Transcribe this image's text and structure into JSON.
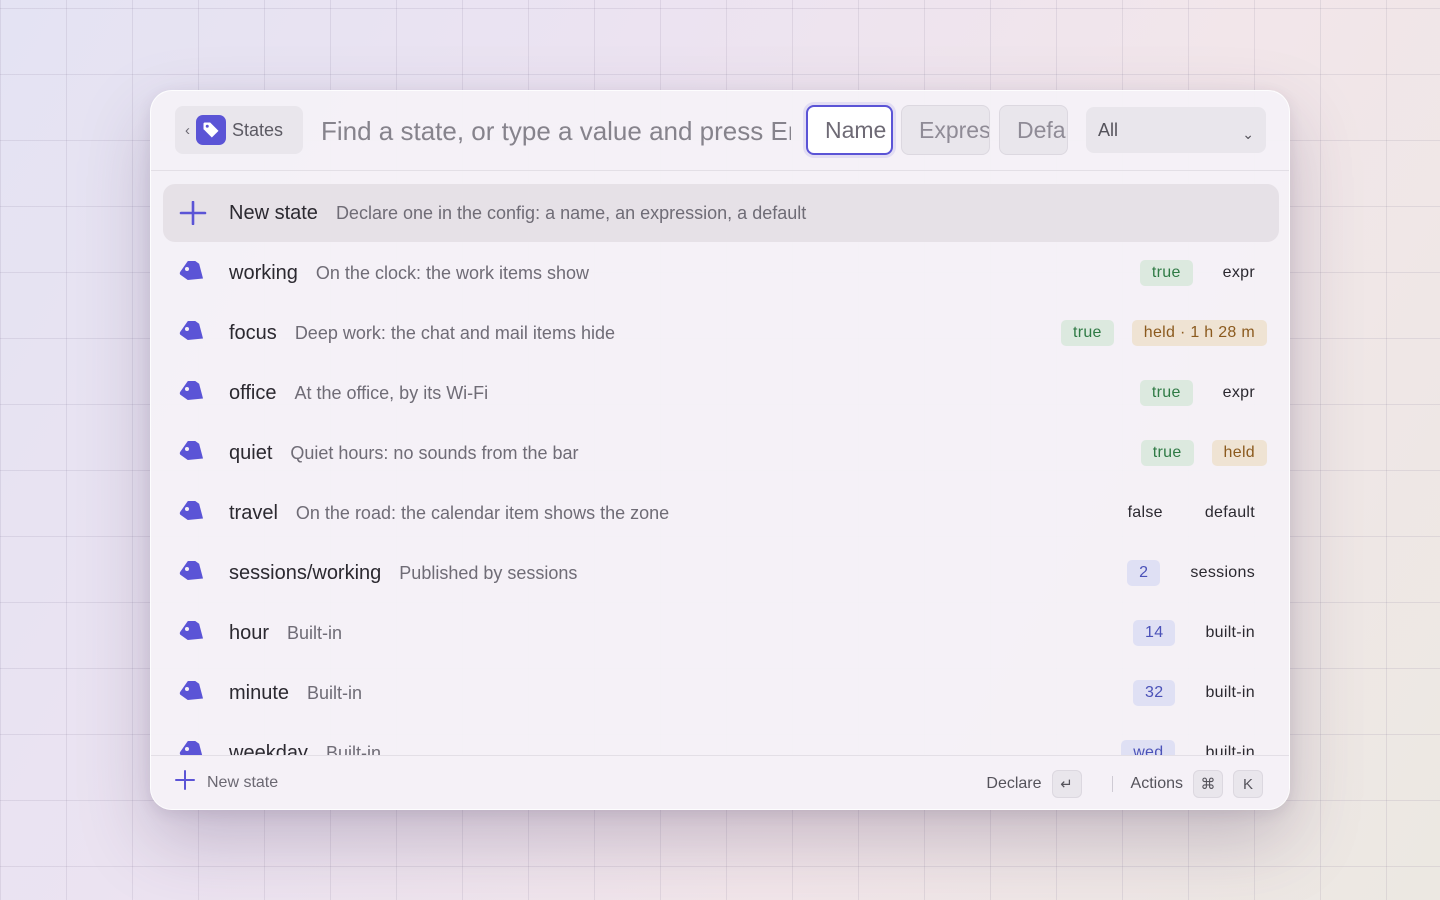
{
  "header": {
    "back_label": "States",
    "search_placeholder": "Find a state, or type a value and press Enter",
    "filters": [
      "Name",
      "Expression",
      "Default"
    ],
    "select_value": "All"
  },
  "rows": [
    {
      "name": "New state",
      "desc": "Declare one in the config: a name, an expression, a default",
      "badges": []
    },
    {
      "name": "working",
      "desc": "On the clock: the work items show",
      "badges": [
        {
          "text": "true",
          "kind": "true"
        },
        {
          "text": "expr",
          "kind": "plain"
        }
      ]
    },
    {
      "name": "focus",
      "desc": "Deep work: the chat and mail items hide",
      "badges": [
        {
          "text": "true",
          "kind": "true"
        },
        {
          "text": "held · 1 h 28 m",
          "kind": "held"
        }
      ]
    },
    {
      "name": "office",
      "desc": "At the office, by its Wi-Fi",
      "badges": [
        {
          "text": "true",
          "kind": "true"
        },
        {
          "text": "expr",
          "kind": "plain"
        }
      ]
    },
    {
      "name": "quiet",
      "desc": "Quiet hours: no sounds from the bar",
      "badges": [
        {
          "text": "true",
          "kind": "true"
        },
        {
          "text": "held",
          "kind": "held"
        }
      ]
    },
    {
      "name": "travel",
      "desc": "On the road: the calendar item shows the zone",
      "badges": [
        {
          "text": "false",
          "kind": "plain"
        },
        {
          "text": "default",
          "kind": "plain"
        }
      ]
    },
    {
      "name": "sessions/working",
      "desc": "Published by sessions",
      "badges": [
        {
          "text": "2",
          "kind": "num"
        },
        {
          "text": "sessions",
          "kind": "plain"
        }
      ]
    },
    {
      "name": "hour",
      "desc": "Built-in",
      "badges": [
        {
          "text": "14",
          "kind": "num"
        },
        {
          "text": "built-in",
          "kind": "plain"
        }
      ]
    },
    {
      "name": "minute",
      "desc": "Built-in",
      "badges": [
        {
          "text": "32",
          "kind": "num"
        },
        {
          "text": "built-in",
          "kind": "plain"
        }
      ]
    },
    {
      "name": "weekday",
      "desc": "Built-in",
      "badges": [
        {
          "text": "wed",
          "kind": "num"
        },
        {
          "text": "built-in",
          "kind": "plain"
        }
      ]
    }
  ],
  "footer": {
    "new_label": "New state",
    "declare_label": "Declare",
    "declare_key": "↵",
    "actions_label": "Actions",
    "actions_keys": [
      "⌘",
      "K"
    ]
  },
  "colors": {
    "accent": "#5b54d6",
    "true_bg": "#dce9df",
    "held_bg": "#efe3d3",
    "num_bg": "#dfe0f4"
  }
}
